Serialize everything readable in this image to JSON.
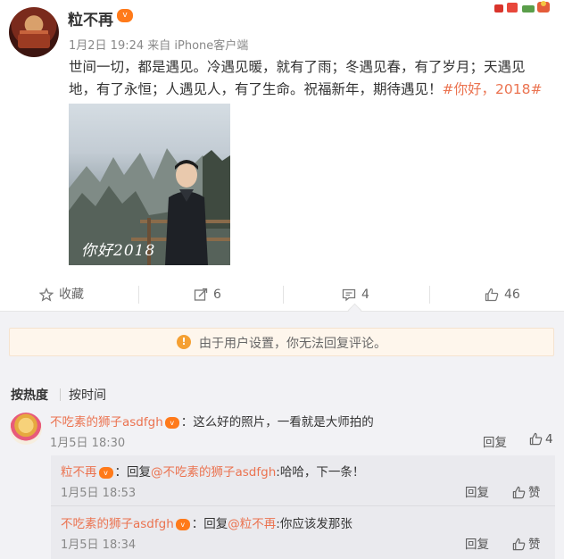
{
  "post": {
    "username": "粒不再",
    "vip_badge": "v",
    "meta": "1月2日 19:24 来自 iPhone客户端",
    "text_line1": "世间一切，都是遇见。冷遇见暖，就有了雨；冬遇见春，有了岁月；天遇见",
    "text_line2_plain": "地，有了永恒；人遇见人，有了生命。祝福新年，期待遇见！",
    "hashtag": "#你好，2018#",
    "photo_overlay": "你好2018"
  },
  "actions": {
    "favorite_label": "收藏",
    "repost_count": "6",
    "comment_count": "4",
    "like_count": "46"
  },
  "notice": {
    "text": "由于用户设置，你无法回复评论。"
  },
  "sort": {
    "hot": "按热度",
    "time": "按时间"
  },
  "comments": [
    {
      "name": "不吃素的狮子asdfgh",
      "text": "：这么好的照片，一看就是大师拍的",
      "time": "1月5日 18:30",
      "reply_label": "回复",
      "like_count": "4"
    }
  ],
  "replies": [
    {
      "name": "粒不再",
      "reply_prefix": "：回复",
      "mention": "@不吃素的狮子asdfgh",
      "text": ":哈哈，下一条！",
      "time": "1月5日 18:53",
      "reply_label": "回复",
      "like_label": "赞"
    },
    {
      "name": "不吃素的狮子asdfgh",
      "reply_prefix": "：回复",
      "mention": "@粒不再",
      "text": ":你应该发那张",
      "time": "1月5日 18:34",
      "reply_label": "回复",
      "like_label": "赞"
    }
  ],
  "colors": {
    "accent": "#eb7350",
    "link": "#eb7350",
    "notice_bg": "#fef6ec",
    "comment_bg": "#f2f2f5"
  }
}
